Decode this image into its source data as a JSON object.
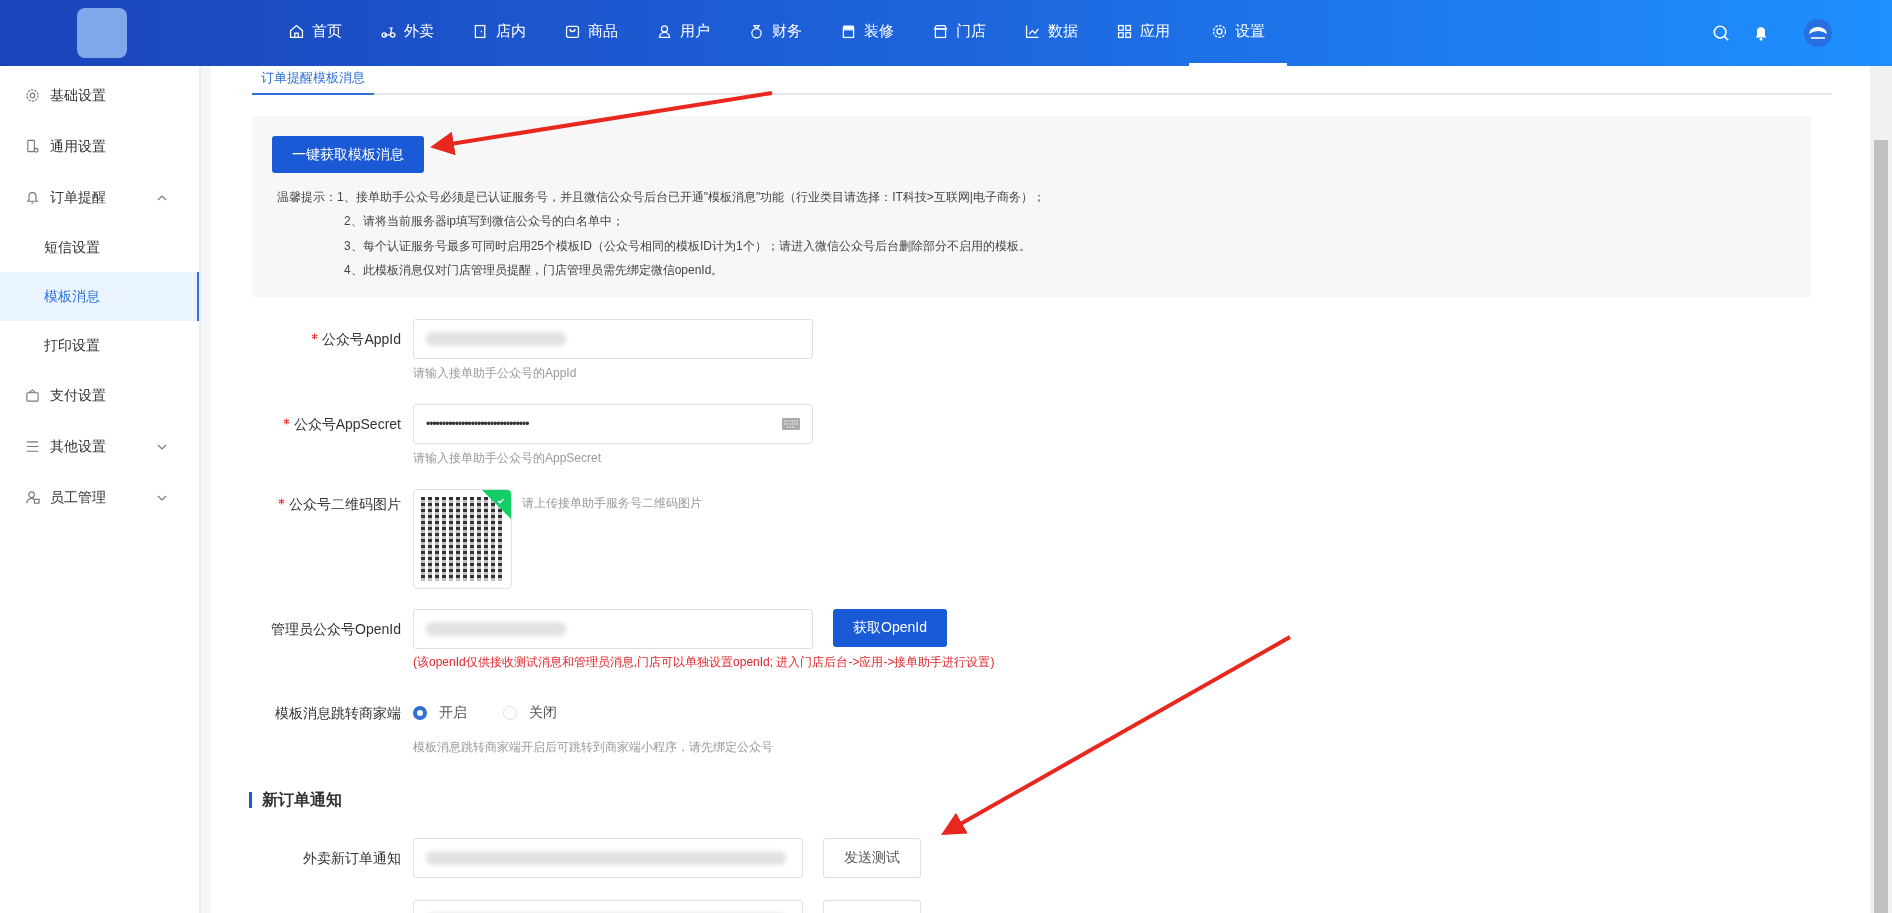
{
  "top_nav": {
    "items": [
      {
        "label": "首页",
        "selected": false
      },
      {
        "label": "外卖",
        "selected": false
      },
      {
        "label": "店内",
        "selected": false
      },
      {
        "label": "商品",
        "selected": false
      },
      {
        "label": "用户",
        "selected": false
      },
      {
        "label": "财务",
        "selected": false
      },
      {
        "label": "装修",
        "selected": false
      },
      {
        "label": "门店",
        "selected": false
      },
      {
        "label": "数据",
        "selected": false
      },
      {
        "label": "应用",
        "selected": false
      },
      {
        "label": "设置",
        "selected": true
      }
    ]
  },
  "sidebar": {
    "items": [
      {
        "label": "基础设置",
        "selected": false
      },
      {
        "label": "通用设置",
        "selected": false
      },
      {
        "label": "订单提醒",
        "expanded": true,
        "children": [
          {
            "label": "短信设置",
            "selected": false
          },
          {
            "label": "模板消息",
            "selected": true
          },
          {
            "label": "打印设置",
            "selected": false
          }
        ]
      },
      {
        "label": "支付设置",
        "selected": false
      },
      {
        "label": "其他设置",
        "expanded": false
      },
      {
        "label": "员工管理",
        "expanded": false
      }
    ]
  },
  "tabs": [
    {
      "label": "订单提醒模板消息",
      "selected": true
    }
  ],
  "notice": {
    "button": "一键获取模板消息",
    "prefix": "温馨提示：",
    "lines": [
      "1、接单助手公众号必须是已认证服务号，并且微信公众号后台已开通\"模板消息\"功能（行业类目请选择：IT科技>互联网|电子商务）；",
      "2、请将当前服务器ip填写到微信公众号的白名单中；",
      "3、每个认证服务号最多可同时启用25个模板ID（公众号相同的模板ID计为1个）；请进入微信公众号后台删除部分不启用的模板。",
      "4、此模板消息仅对门店管理员提醒，门店管理员需先绑定微信openId。"
    ]
  },
  "form": {
    "fields": [
      {
        "kind": "text",
        "label": "公众号AppId",
        "required": true,
        "hint": "请输入接单助手公众号的AppId"
      },
      {
        "kind": "password",
        "label": "公众号AppSecret",
        "required": true,
        "value": "••••••••••••••••••••••••••••••••",
        "hint": "请输入接单助手公众号的AppSecret"
      },
      {
        "kind": "image",
        "label": "公众号二维码图片",
        "required": true,
        "uploaded": true,
        "hint": "请上传接单助手服务号二维码图片"
      },
      {
        "kind": "text",
        "label": "管理员公众号OpenId",
        "required": false,
        "button": "获取OpenId",
        "note": "(该openId仅供接收测试消息和管理员消息,门店可以单独设置openId; 进入门店后台->应用->接单助手进行设置)"
      },
      {
        "kind": "radio",
        "label": "模板消息跳转商家端",
        "options": [
          {
            "label": "开启",
            "selected": true
          },
          {
            "label": "关闭",
            "selected": false
          }
        ],
        "hint": "模板消息跳转商家端开启后可跳转到商家端小程序，请先绑定公众号"
      }
    ]
  },
  "sections": [
    {
      "title": "新订单通知",
      "rows": [
        {
          "kind": "full",
          "label": "外卖新订单通知",
          "button": "发送测试"
        },
        {
          "kind": "cut"
        }
      ]
    }
  ]
}
